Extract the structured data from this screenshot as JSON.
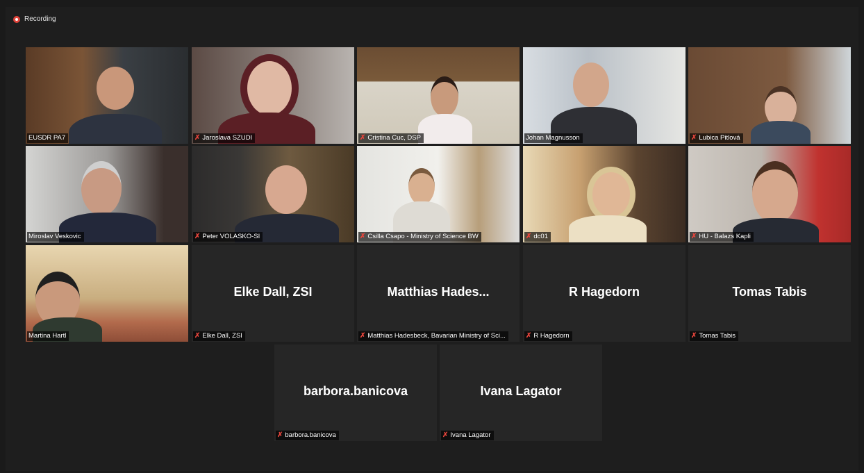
{
  "recording": {
    "label": "Recording"
  },
  "participants": [
    {
      "name": "EUSDR PA7"
    },
    {
      "name": "Jaroslava SZUDI"
    },
    {
      "name": "Cristina Cuc, DSP"
    },
    {
      "name": "Johan Magnusson"
    },
    {
      "name": "Lubica Pitlová"
    },
    {
      "name": "Miroslav Veskovic"
    },
    {
      "name": "Peter VOLASKO-SI"
    },
    {
      "name": "Csilla Csapo - Ministry of Science BW"
    },
    {
      "name": "dc01"
    },
    {
      "name": "HU - Balazs Kapli"
    },
    {
      "name": "Martina Hartl"
    },
    {
      "name": "Elke Dall, ZSI",
      "display": "Elke Dall, ZSI"
    },
    {
      "name": "Matthias Hadesbeck, Bavarian  Ministry of Sci...",
      "display": "Matthias  Hades..."
    },
    {
      "name": "R Hagedorn",
      "display": "R Hagedorn"
    },
    {
      "name": "Tomas Tabis",
      "display": "Tomas Tabis"
    },
    {
      "name": "barbora.banicova",
      "display": "barbora.banicova"
    },
    {
      "name": "Ivana Lagator",
      "display": "Ivana Lagator"
    }
  ],
  "colors": {
    "active_speaker_border": "#c6d84a",
    "muted_icon": "#e8453c",
    "tile_bg": "#262626"
  }
}
